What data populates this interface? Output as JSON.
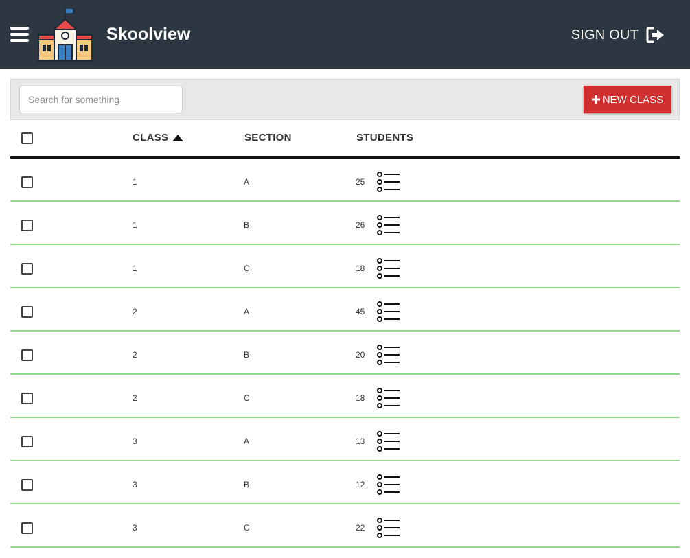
{
  "header": {
    "app_name": "Skoolview",
    "menu_icon": "hamburger-menu-icon",
    "logo_icon": "school-building-icon",
    "signout_label": "SIGN OUT",
    "signout_icon": "sign-out-icon",
    "background_color": "#2c3742"
  },
  "toolbar": {
    "search_placeholder": "Search for something",
    "search_value": "",
    "new_class_label": "NEW CLASS",
    "new_class_icon": "plus-icon",
    "accent_color": "#d0302f"
  },
  "table": {
    "columns": [
      "CLASS",
      "SECTION",
      "STUDENTS"
    ],
    "sort_column": "CLASS",
    "sort_direction": "ascending",
    "row_action_icon": "list-icon",
    "rows": [
      {
        "class": "1",
        "section": "A",
        "students": "25"
      },
      {
        "class": "1",
        "section": "B",
        "students": "26"
      },
      {
        "class": "1",
        "section": "C",
        "students": "18"
      },
      {
        "class": "2",
        "section": "A",
        "students": "45"
      },
      {
        "class": "2",
        "section": "B",
        "students": "20"
      },
      {
        "class": "2",
        "section": "C",
        "students": "18"
      },
      {
        "class": "3",
        "section": "A",
        "students": "13"
      },
      {
        "class": "3",
        "section": "B",
        "students": "12"
      },
      {
        "class": "3",
        "section": "C",
        "students": "22"
      }
    ],
    "row_divider_color": "#8ed98a"
  }
}
